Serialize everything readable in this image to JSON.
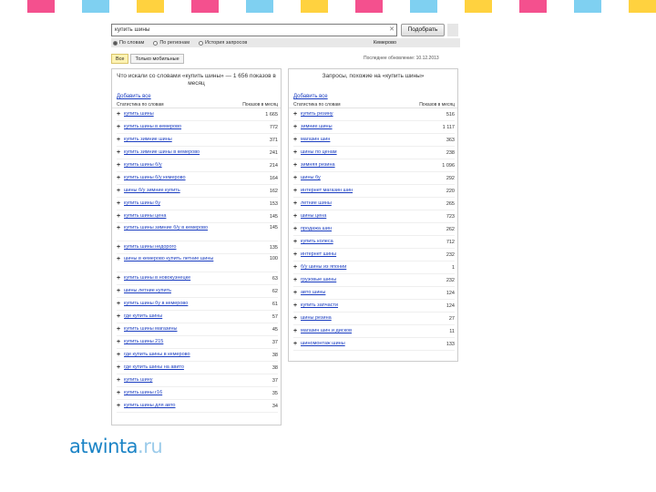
{
  "stripe_colors": [
    "#ffffff",
    "#f4508e",
    "#ffffff",
    "#7fd0f1",
    "#ffffff",
    "#ffd23f",
    "#ffffff",
    "#f4508e",
    "#ffffff",
    "#7fd0f1",
    "#ffffff",
    "#ffd23f",
    "#ffffff",
    "#f4508e",
    "#ffffff",
    "#7fd0f1",
    "#ffffff",
    "#ffd23f",
    "#ffffff",
    "#f4508e",
    "#ffffff",
    "#7fd0f1",
    "#ffffff",
    "#ffd23f"
  ],
  "search": {
    "query": "купить шины",
    "clear_icon": "close-icon",
    "submit_label": "Подобрать"
  },
  "radios": {
    "options": [
      {
        "label": "По словам",
        "selected": true
      },
      {
        "label": "По регионам",
        "selected": false
      },
      {
        "label": "История запросов",
        "selected": false
      }
    ],
    "region": "Кемерово"
  },
  "tabs": [
    {
      "label": "Все",
      "active": true
    },
    {
      "label": "Только мобильные",
      "active": false
    }
  ],
  "updated_text": "Последнее обновление: 10.12.2013",
  "left_panel": {
    "title": "Что искали со словами «купить шины» — 1 656 показов в месяц",
    "add_all": "Добавить все",
    "col_phrase": "Статистика по словам",
    "col_count": "Показов в месяц",
    "rows": [
      {
        "phrase": "купить шины",
        "count": "1 665"
      },
      {
        "phrase": "купить шины в кемерово",
        "count": "772"
      },
      {
        "phrase": "купить зимние шины",
        "count": "371"
      },
      {
        "phrase": "купить зимние шины в кемерово",
        "count": "241"
      },
      {
        "phrase": "купить шины б/у",
        "count": "214"
      },
      {
        "phrase": "купить шины б/у кемерово",
        "count": "164"
      },
      {
        "phrase": "шины б/у зимние купить",
        "count": "162"
      },
      {
        "phrase": "купить шины бу",
        "count": "153"
      },
      {
        "phrase": "купить шины цена",
        "count": "145"
      },
      {
        "phrase": "купить шины зимние б/у в кемерово",
        "count": "145",
        "tall": true
      },
      {
        "phrase": "купить шины недорого",
        "count": "135"
      },
      {
        "phrase": "шины в кемерово купить летние шины",
        "count": "100",
        "tall": true
      },
      {
        "phrase": "купить шины в новокузнецке",
        "count": "63"
      },
      {
        "phrase": "шины летние купить",
        "count": "62"
      },
      {
        "phrase": "купить шины бу в кемерово",
        "count": "61"
      },
      {
        "phrase": "где купить шины",
        "count": "57"
      },
      {
        "phrase": "купить шины магазины",
        "count": "45"
      },
      {
        "phrase": "купить шины 215",
        "count": "37"
      },
      {
        "phrase": "где купить шины в кемерово",
        "count": "38"
      },
      {
        "phrase": "где купить шины на авито",
        "count": "38"
      },
      {
        "phrase": "купить шину",
        "count": "37"
      },
      {
        "phrase": "купить шины r16",
        "count": "35"
      },
      {
        "phrase": "купить шины для авто",
        "count": "34"
      }
    ]
  },
  "right_panel": {
    "title": "Запросы, похожие на «купить шины»",
    "add_all": "Добавить все",
    "col_phrase": "Статистика по словам",
    "col_count": "Показов в месяц",
    "rows": [
      {
        "phrase": "купить резину",
        "count": "516"
      },
      {
        "phrase": "зимние шины",
        "count": "1 117"
      },
      {
        "phrase": "магазин шин",
        "count": "363"
      },
      {
        "phrase": "шины по ценам",
        "count": "238"
      },
      {
        "phrase": "зимняя резина",
        "count": "1 096"
      },
      {
        "phrase": "шины бу",
        "count": "292"
      },
      {
        "phrase": "интернет магазин шин",
        "count": "220"
      },
      {
        "phrase": "летние шины",
        "count": "265"
      },
      {
        "phrase": "шины цена",
        "count": "723"
      },
      {
        "phrase": "продажа шин",
        "count": "262"
      },
      {
        "phrase": "купить колеса",
        "count": "712"
      },
      {
        "phrase": "интернет шины",
        "count": "232"
      },
      {
        "phrase": "б/у шины из японии",
        "count": "1"
      },
      {
        "phrase": "грузовые шины",
        "count": "232"
      },
      {
        "phrase": "авто шины",
        "count": "124"
      },
      {
        "phrase": "купить запчасти",
        "count": "124"
      },
      {
        "phrase": "шины резина",
        "count": "27"
      },
      {
        "phrase": "магазин шин и дисков",
        "count": "11"
      },
      {
        "phrase": "шиномонтаж шины",
        "count": "133"
      }
    ]
  },
  "logo": {
    "name": "atwinta",
    "tld": ".ru"
  }
}
